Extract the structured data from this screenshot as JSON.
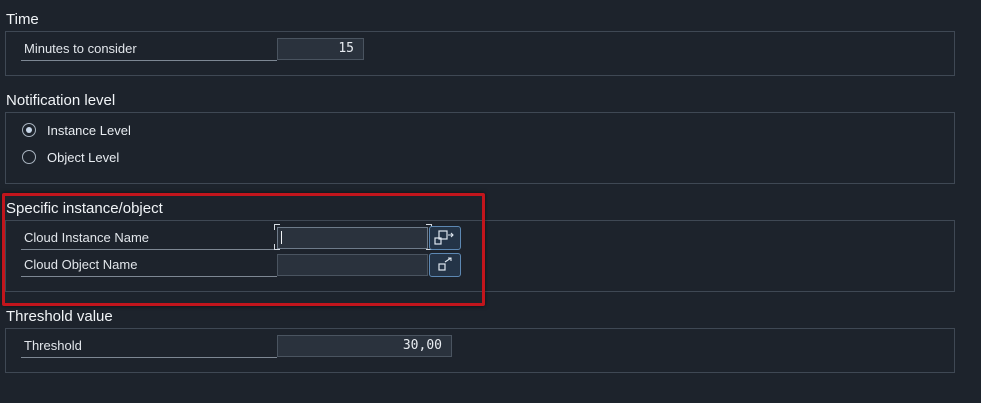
{
  "time": {
    "title": "Time",
    "minutes_label": "Minutes to consider",
    "minutes_value": "15"
  },
  "notification": {
    "title": "Notification level",
    "options": [
      {
        "label": "Instance Level",
        "selected": true
      },
      {
        "label": "Object Level",
        "selected": false
      }
    ]
  },
  "specific": {
    "title": "Specific instance/object",
    "instance_label": "Cloud Instance Name",
    "instance_value": "",
    "object_label": "Cloud Object Name",
    "object_value": ""
  },
  "threshold": {
    "title": "Threshold value",
    "label": "Threshold",
    "value": "30,00"
  },
  "colors": {
    "background": "#1d232c",
    "field_bg": "#2a323d",
    "highlight": "#c2151c",
    "button_border": "#5d88b3"
  },
  "icons": {
    "value_help": "value-help-icon"
  }
}
